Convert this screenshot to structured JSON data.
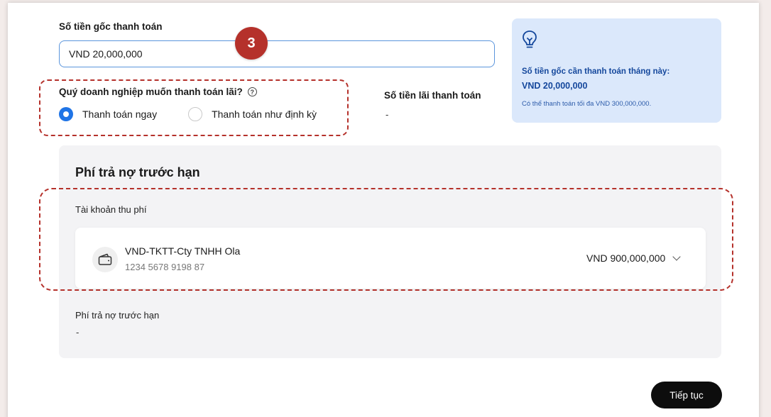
{
  "principal": {
    "label": "Số tiền gốc thanh toán",
    "value": "VND 20,000,000"
  },
  "step_badge": "3",
  "interest_question": {
    "label": "Quý doanh nghiệp muốn thanh toán lãi?",
    "help_icon": "?",
    "options": [
      {
        "label": "Thanh toán ngay",
        "selected": true
      },
      {
        "label": "Thanh toán như định kỳ",
        "selected": false
      }
    ]
  },
  "interest_amount": {
    "label": "Số tiền lãi thanh toán",
    "value": "-"
  },
  "info_card": {
    "icon": "lightbulb-icon",
    "line1": "Số tiền gốc cần thanh toán tháng này:",
    "line2": "VND 20,000,000",
    "note": "Có thể thanh toán tối đa VND 300,000,000."
  },
  "fee_section": {
    "title": "Phí trả nợ trước hạn",
    "account_label": "Tài khoản thu phí",
    "account": {
      "icon": "wallet-icon",
      "name": "VND-TKTT-Cty TNHH Ola",
      "number": "1234 5678 9198 87",
      "balance": "VND 900,000,000"
    },
    "fee_label": "Phí  trả nợ trước hạn",
    "fee_value": "-"
  },
  "continue_button": "Tiếp tục",
  "colors": {
    "accent_blue": "#1f74e6",
    "annotation_red": "#b5312b",
    "info_bg": "#dbe8fb",
    "info_text": "#14479c"
  }
}
